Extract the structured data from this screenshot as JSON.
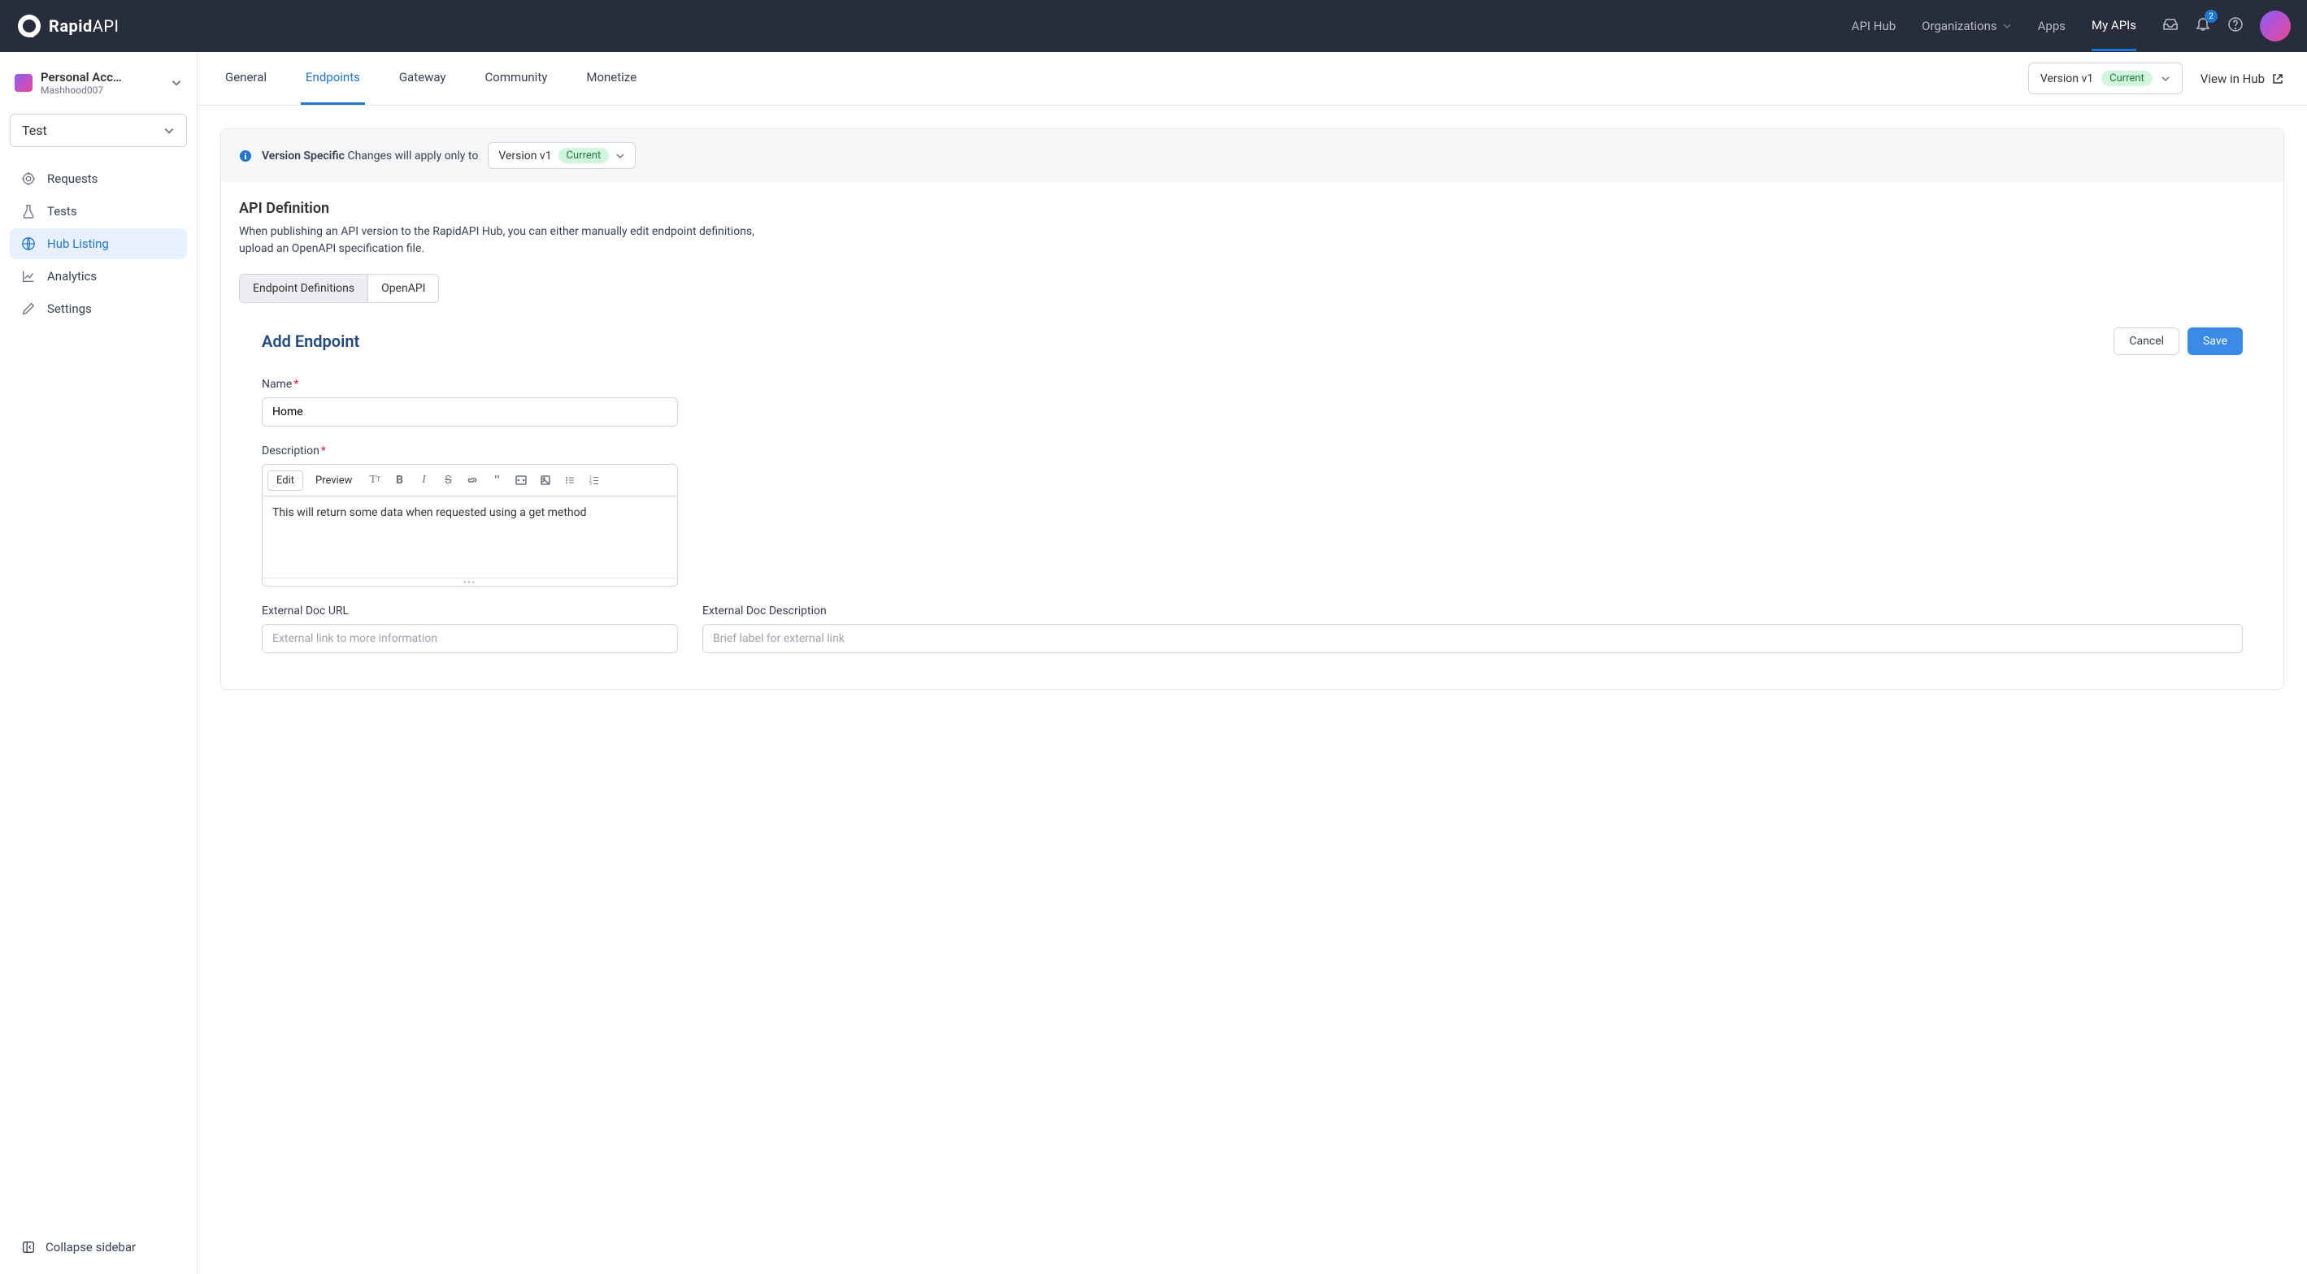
{
  "header": {
    "logo_main": "Rapid",
    "logo_sub": "API",
    "nav": {
      "api_hub": "API Hub",
      "organizations": "Organizations",
      "apps": "Apps",
      "my_apis": "My APIs"
    },
    "badge_count": "2"
  },
  "sidebar": {
    "account_name": "Personal Acc…",
    "account_sub": "Mashhood007",
    "project": "Test",
    "items": {
      "requests": "Requests",
      "tests": "Tests",
      "hub_listing": "Hub Listing",
      "analytics": "Analytics",
      "settings": "Settings"
    },
    "collapse": "Collapse sidebar"
  },
  "tabs": {
    "general": "General",
    "endpoints": "Endpoints",
    "gateway": "Gateway",
    "community": "Community",
    "monetize": "Monetize"
  },
  "version": {
    "label": "Version v1",
    "badge": "Current"
  },
  "view_hub": "View in Hub",
  "banner": {
    "strong": "Version Specific",
    "rest": "Changes will apply only to"
  },
  "api_def": {
    "title": "API Definition",
    "desc": "When publishing an API version to the RapidAPI Hub, you can either manually edit endpoint definitions, upload an OpenAPI specification file.",
    "toggle": {
      "defs": "Endpoint Definitions",
      "openapi": "OpenAPI"
    }
  },
  "form": {
    "title": "Add Endpoint",
    "cancel": "Cancel",
    "save": "Save",
    "name_label": "Name",
    "name_value": "Home",
    "desc_label": "Description",
    "editor": {
      "edit": "Edit",
      "preview": "Preview",
      "content": "This will return some data when requested using a get method"
    },
    "ext_url_label": "External Doc URL",
    "ext_url_placeholder": "External link to more information",
    "ext_desc_label": "External Doc Description",
    "ext_desc_placeholder": "Brief label for external link"
  }
}
